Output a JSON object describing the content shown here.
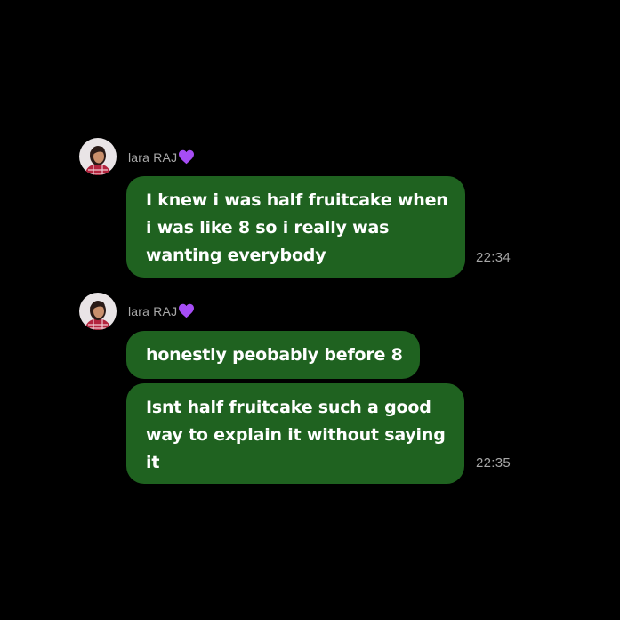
{
  "chat": {
    "groups": [
      {
        "sender": {
          "name": "lara RAJ",
          "emoji": "purple-heart",
          "emoji_color": "#a64df5"
        },
        "messages": [
          {
            "lines": [
              "I knew i was half fruitcake when",
              "i was like 8 so i really was",
              "wanting everybody"
            ],
            "time": "22:34"
          }
        ]
      },
      {
        "sender": {
          "name": "lara RAJ",
          "emoji": "purple-heart",
          "emoji_color": "#a64df5"
        },
        "messages": [
          {
            "lines": [
              "honestly peobably before 8"
            ],
            "time": ""
          },
          {
            "lines": [
              "Isnt half fruitcake such a good",
              "way to explain it without saying",
              "it"
            ],
            "time": "22:35"
          }
        ]
      }
    ]
  },
  "colors": {
    "background": "#000000",
    "bubble": "#1f6220",
    "bubble_text": "#ffffff",
    "meta_text": "#a8a8a8"
  }
}
